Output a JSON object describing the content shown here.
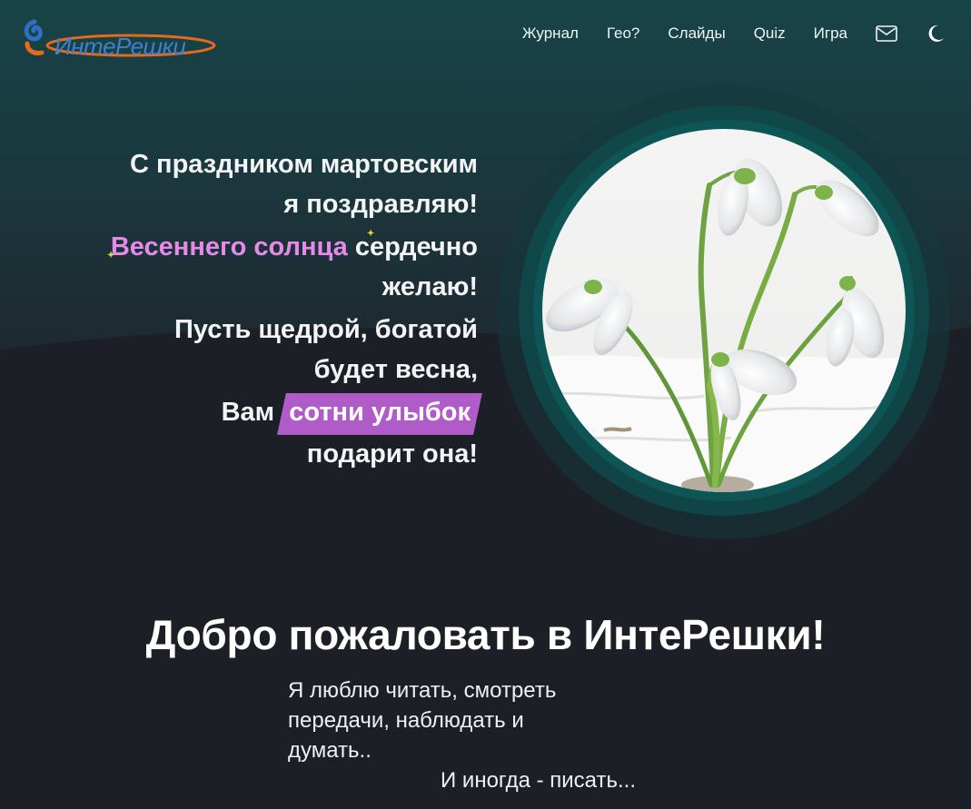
{
  "site": {
    "logo_text": "ИнтеРешки"
  },
  "nav": {
    "items": [
      {
        "label": "Журнал"
      },
      {
        "label": "Гео?"
      },
      {
        "label": "Слайды"
      },
      {
        "label": "Quiz"
      },
      {
        "label": "Игра"
      }
    ],
    "mail_icon": "mail-icon",
    "theme_icon": "moon-icon"
  },
  "poem": {
    "s1_l1": "С праздником мартовским",
    "s1_l2": "я поздравляю!",
    "s2_hl": "Весеннего солнца",
    "s2_rest": " сердечно",
    "s2_l2": "желаю!",
    "s3_l1": "Пусть щедрой, богатой",
    "s3_l2": "будет весна,",
    "s4_pre": "Вам ",
    "s4_hl": "сотни улыбок",
    "s4_l2": "подарит она!"
  },
  "hero_image": "snowdrop-flowers",
  "welcome": {
    "title": "Добро пожаловать в ИнтеРешки!"
  },
  "intro": {
    "line1": "Я люблю читать, смотреть",
    "line2": "передачи, наблюдать и",
    "line3": "думать..",
    "line4": "И иногда - писать..."
  },
  "colors": {
    "background": "#1c1f26",
    "hero_teal": "#174447",
    "accent_pink": "#e58ae8",
    "accent_purple": "#b05cc8",
    "logo_blue": "#3f7fd0",
    "logo_orange": "#e8681e"
  }
}
